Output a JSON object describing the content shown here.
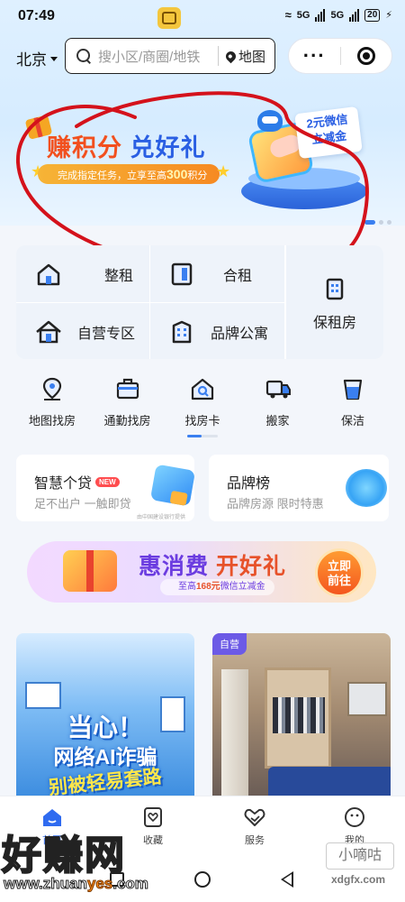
{
  "status_bar": {
    "time": "07:49",
    "signal1": "5G",
    "signal2": "5G",
    "battery": "20"
  },
  "header": {
    "city": "北京",
    "search_placeholder": "搜小区/商圈/地铁",
    "map_label": "地图",
    "more_label": "···"
  },
  "banner": {
    "title_part1": "赚积分",
    "title_part2": "兑好礼",
    "subtitle_prefix": "完成指定任务，立享至高",
    "subtitle_points": "300",
    "subtitle_suffix": "积分",
    "coupon_line1": "2元微信",
    "coupon_line2": "立减金",
    "accent_color": "#f2501e"
  },
  "categories": [
    {
      "label": "整租",
      "icon": "house-icon"
    },
    {
      "label": "合租",
      "icon": "door-icon"
    },
    {
      "label": "保租房",
      "icon": "building-icon"
    },
    {
      "label": "自营专区",
      "icon": "home-icon"
    },
    {
      "label": "品牌公寓",
      "icon": "apartment-icon"
    }
  ],
  "quick_actions": [
    {
      "label": "地图找房",
      "icon": "map-pin-icon"
    },
    {
      "label": "通勤找房",
      "icon": "briefcase-icon"
    },
    {
      "label": "找房卡",
      "icon": "house-search-icon"
    },
    {
      "label": "搬家",
      "icon": "truck-icon"
    },
    {
      "label": "保洁",
      "icon": "bucket-icon"
    }
  ],
  "promos": {
    "loan": {
      "title": "智慧个贷",
      "badge": "NEW",
      "subtitle": "足不出户 一触即贷",
      "note": "由中国建设银行提供"
    },
    "ranking": {
      "title": "品牌榜",
      "subtitle": "品牌房源 限时特惠"
    }
  },
  "sale_banner": {
    "title_part1": "惠消费",
    "title_part2": "开好礼",
    "sub_prefix": "至高",
    "sub_amount": "168元",
    "sub_suffix": "微信立减金",
    "cta_line1": "立即",
    "cta_line2": "前往"
  },
  "cards": {
    "left": {
      "line1": "当心！",
      "line2": "网络AI诈骗",
      "line3": "别被轻易套路"
    },
    "right": {
      "tag": "自营"
    }
  },
  "tabbar": [
    {
      "label": "首页",
      "icon": "home-tab-icon",
      "active": true
    },
    {
      "label": "收藏",
      "icon": "favorite-icon"
    },
    {
      "label": "服务",
      "icon": "heart-hand-icon"
    },
    {
      "label": "我的",
      "icon": "profile-icon"
    }
  ],
  "watermark": {
    "brand": "好赚网",
    "url_part1": "www.zhuan",
    "url_part2": "yes",
    "url_part3": ".com",
    "small_brand": "小嘀咕",
    "small_url": "xdgfx.com"
  },
  "colors": {
    "primary": "#2f6bf0",
    "annotation_red": "#d4121b"
  }
}
